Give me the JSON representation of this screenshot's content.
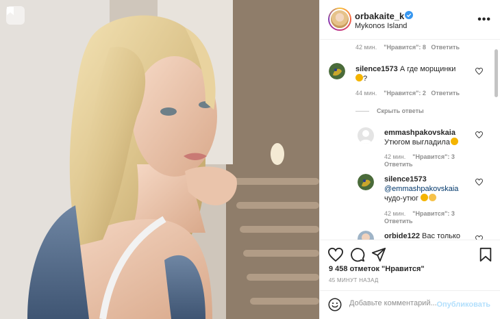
{
  "post": {
    "username": "orbakaite_k",
    "location": "Mykonos Island",
    "likes_count": "9 458",
    "likes_suffix": "отметок \"Нравится\"",
    "time_ago": "45 МИНУТ НАЗАД"
  },
  "comments": {
    "prev_meta": {
      "time": "42 мин.",
      "likes": "\"Нравится\": 8",
      "reply": "Ответить"
    },
    "c1": {
      "username": "silence1573",
      "text": "А где морщинки",
      "text2": "?",
      "time": "44 мин.",
      "likes": "\"Нравится\": 2",
      "reply": "Ответить"
    },
    "hide_replies": "Скрыть ответы",
    "r1": {
      "username": "emmashpakovskaia",
      "text": "Утюгом выгладила",
      "time": "42 мин.",
      "likes": "\"Нравится\": 3",
      "reply": "Ответить"
    },
    "r2": {
      "username": "silence1573",
      "mention": "@emmashpakovskaia",
      "text": "чудо-утюг",
      "time": "42 мин.",
      "likes": "\"Нравится\": 3",
      "reply": "Ответить"
    },
    "r3": {
      "username": "orbide122",
      "text": "Вас только"
    }
  },
  "composer": {
    "placeholder": "Добавьте комментарий...",
    "publish": "Опубликовать"
  },
  "icons": {
    "bookmark": "bookmark-icon",
    "heart": "heart-icon",
    "comment": "comment-icon",
    "share": "share-icon",
    "more": "more-icon",
    "verified": "verified-icon",
    "emoji": "emoji-icon"
  },
  "colors": {
    "link": "#00376b",
    "publish_disabled": "#b2dffc",
    "verified": "#3897f0",
    "muted": "#8e8e8e"
  }
}
